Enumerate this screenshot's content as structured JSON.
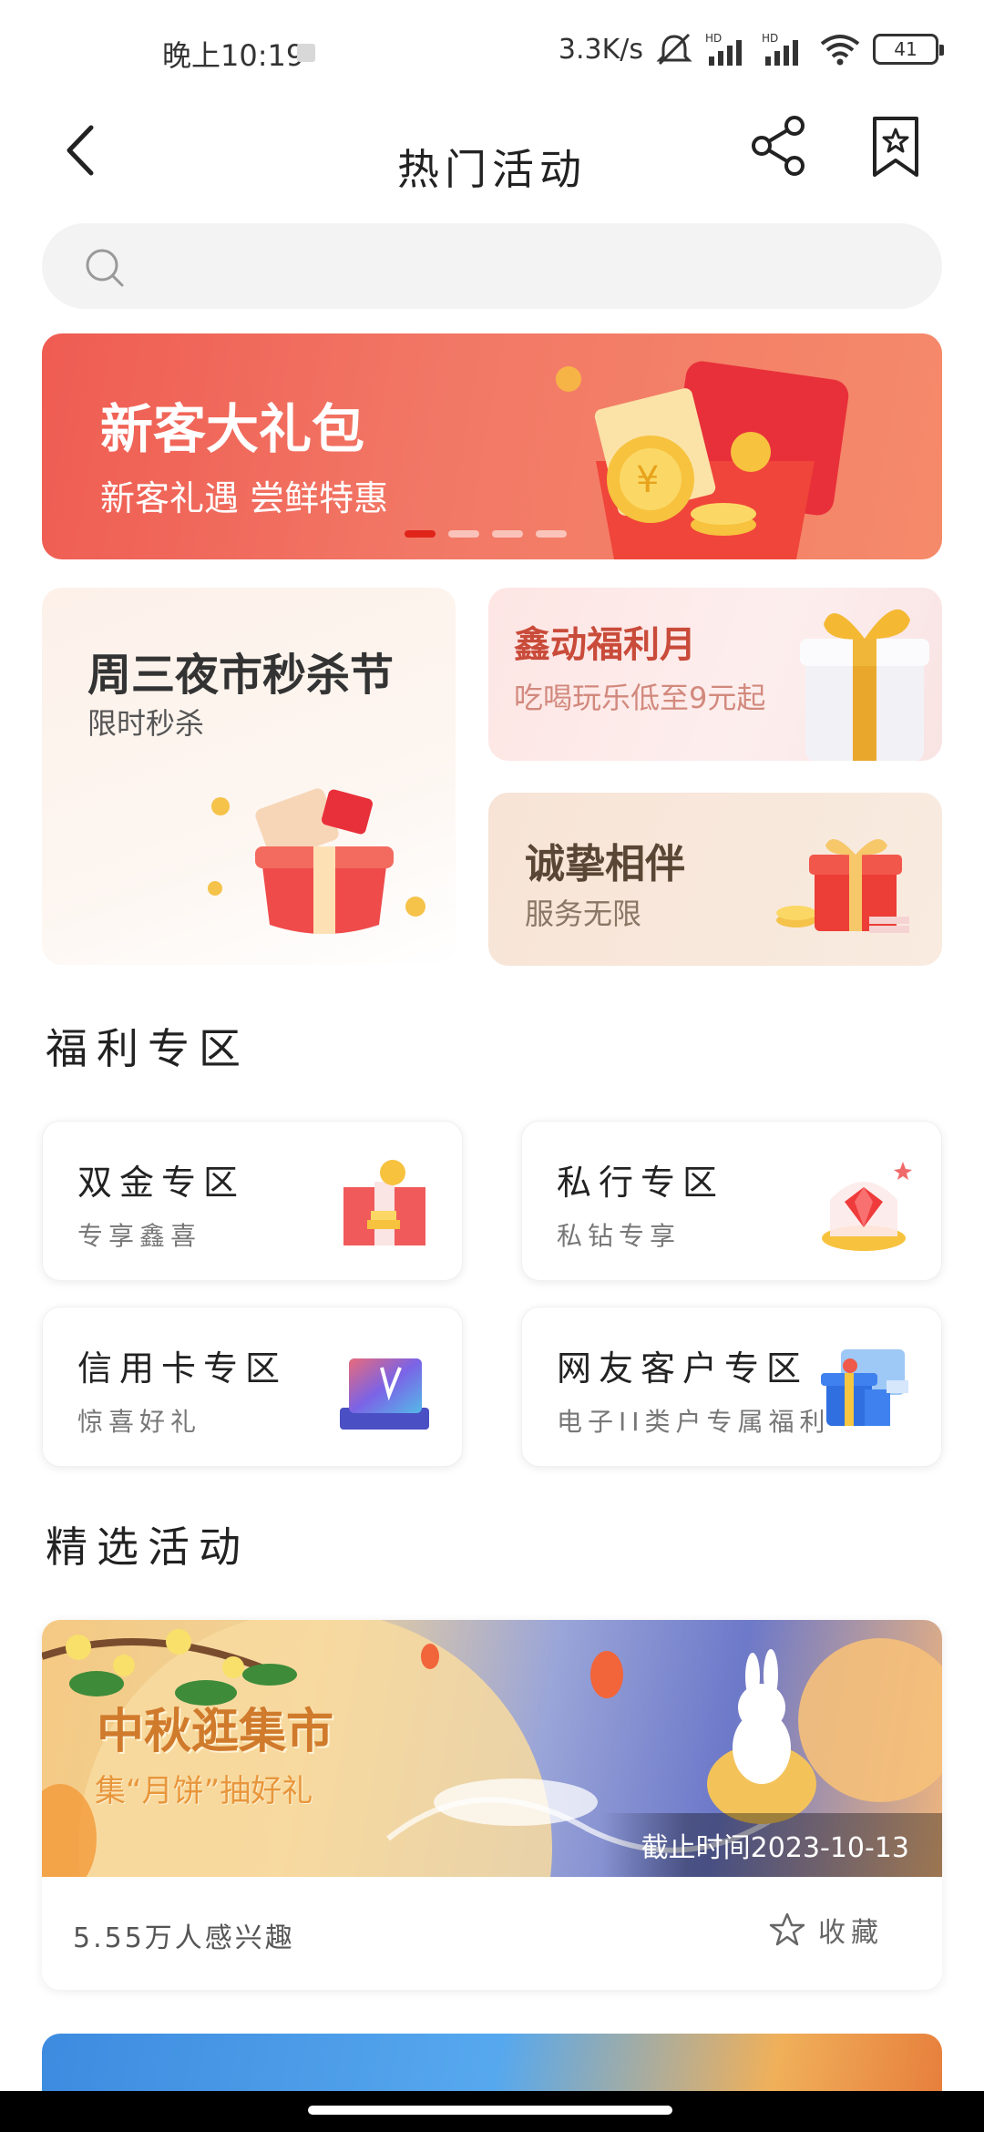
{
  "status_bar": {
    "time": "晚上10:19",
    "network_speed": "3.3K/s",
    "battery": "41"
  },
  "header": {
    "title": "热门活动"
  },
  "search": {
    "placeholder": ""
  },
  "banner": {
    "title": "新客大礼包",
    "subtitle": "新客礼遇 尝鲜特惠",
    "slide_count": 4,
    "active_slide": 1
  },
  "promos": {
    "big": {
      "title": "周三夜市秒杀节",
      "subtitle": "限时秒杀"
    },
    "right_top": {
      "title": "鑫动福利月",
      "subtitle": "吃喝玩乐低至9元起"
    },
    "right_bottom": {
      "title": "诚挚相伴",
      "subtitle": "服务无限"
    }
  },
  "welfare": {
    "section_title": "福利专区",
    "cards": [
      {
        "title": "双金专区",
        "subtitle": "专享鑫喜"
      },
      {
        "title": "私行专区",
        "subtitle": "私钻专享"
      },
      {
        "title": "信用卡专区",
        "subtitle": "惊喜好礼"
      },
      {
        "title": "网友客户专区",
        "subtitle": "电子II类户专属福利"
      }
    ]
  },
  "activities": {
    "section_title": "精选活动",
    "items": [
      {
        "title": "中秋逛集市",
        "subtitle": "集“月饼”抽好礼",
        "deadline": "截止时间2023-10-13",
        "interest": "5.55万人感兴趣",
        "favorite_label": "收藏"
      }
    ]
  },
  "colors": {
    "banner_red": "#ef5c52",
    "active_dot": "#e0241a",
    "promo_red_text": "#c94b3a"
  }
}
